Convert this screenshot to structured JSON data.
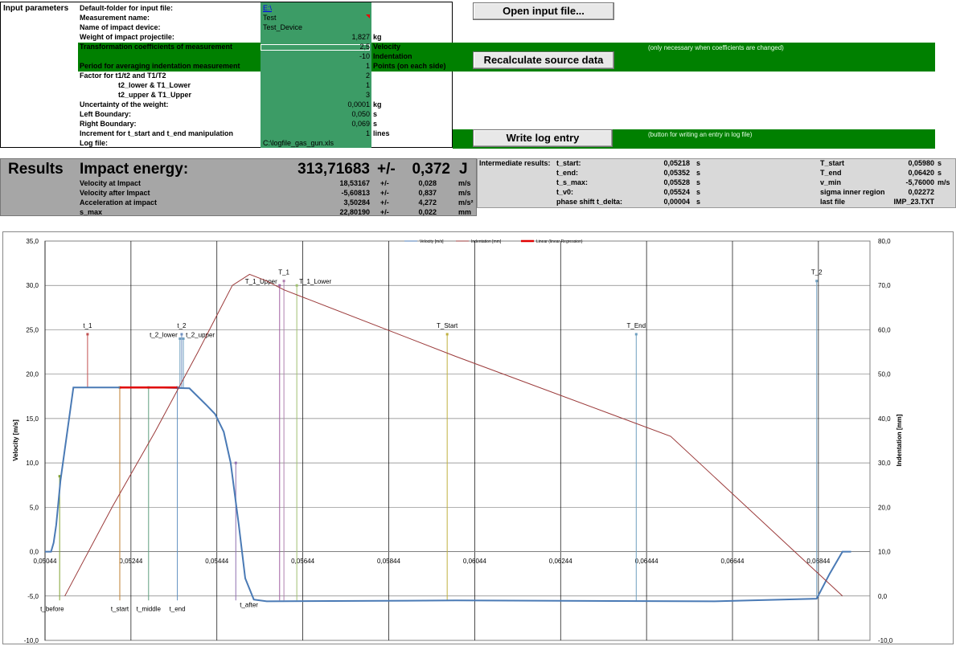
{
  "input": {
    "section_label": "Input parameters",
    "rows": [
      {
        "label": "Default-folder for input file:",
        "value": "E:\\",
        "unit": ""
      },
      {
        "label": "Measurement name:",
        "value": "Test",
        "unit": ""
      },
      {
        "label": "Name of impact device:",
        "value": "Test_Device",
        "unit": ""
      },
      {
        "label": "Weight of impact projectile:",
        "value": "1,827",
        "unit": "kg"
      },
      {
        "label": "Transformation coefficients of measurement",
        "value": "2,5",
        "unit": "Velocity"
      },
      {
        "label": "",
        "value": "-10",
        "unit": "Indentation"
      },
      {
        "label": "Period for averaging indentation measurement",
        "value": "1",
        "unit": "Points (on each side)"
      },
      {
        "label": "Factor for   t1/t2 and T1/T2",
        "value": "2",
        "unit": ""
      },
      {
        "label": "t2_lower & T1_Lower",
        "value": "1",
        "unit": ""
      },
      {
        "label": "t2_upper & T1_Upper",
        "value": "3",
        "unit": ""
      },
      {
        "label": "Uncertainty of the weight:",
        "value": "0,0001",
        "unit": "kg"
      },
      {
        "label": "Left Boundary:",
        "value": "0,050",
        "unit": "s"
      },
      {
        "label": "Right Boundary:",
        "value": "0,069",
        "unit": "s"
      },
      {
        "label": "Increment for t_start and t_end manipulation",
        "value": "1",
        "unit": "lines"
      },
      {
        "label": "Log file:",
        "value": "C:\\logfile_gas_gun.xls",
        "unit": ""
      }
    ]
  },
  "buttons": {
    "open": "Open input file...",
    "recalc": "Recalculate source data",
    "log": "Write log entry"
  },
  "notes": {
    "coeff": "(only necessary when coefficients are changed)",
    "log": "(button for writing an entry in log file)"
  },
  "results": {
    "title": "Results",
    "energy_label": "Impact energy:",
    "energy_value": "313,71683",
    "pm": "+/-",
    "energy_unc": "0,372",
    "energy_unit": "J",
    "rows": [
      {
        "label": "Velocity at Impact",
        "value": "18,53167",
        "pm": "+/-",
        "unc": "0,028",
        "unit": "m/s"
      },
      {
        "label": "Velocity after Impact",
        "value": "-5,60813",
        "pm": "+/-",
        "unc": "0,837",
        "unit": "m/s"
      },
      {
        "label": "Acceleration at impact",
        "value": "3,50284",
        "pm": "+/-",
        "unc": "4,272",
        "unit": "m/s²"
      },
      {
        "label": "s_max",
        "value": "22,80190",
        "pm": "+/-",
        "unc": "0,022",
        "unit": "mm"
      }
    ]
  },
  "intermediate": {
    "title": "Intermediate results:",
    "left": [
      {
        "label": "t_start:",
        "value": "0,05218",
        "unit": "s"
      },
      {
        "label": "t_end:",
        "value": "0,05352",
        "unit": "s"
      },
      {
        "label": "t_s_max:",
        "value": "0,05528",
        "unit": "s"
      },
      {
        "label": "t_v0:",
        "value": "0,05524",
        "unit": "s"
      },
      {
        "label": "phase shift t_delta:",
        "value": "0,00004",
        "unit": "s"
      }
    ],
    "right": [
      {
        "label": "T_start",
        "value": "0,05980",
        "unit": "s"
      },
      {
        "label": "T_end",
        "value": "0,06420",
        "unit": "s"
      },
      {
        "label": "v_min",
        "value": "-5,76000",
        "unit": "m/s"
      },
      {
        "label": "sigma inner region",
        "value": "0,02272",
        "unit": ""
      },
      {
        "label": "last file",
        "value": "IMP_23.TXT",
        "unit": ""
      }
    ]
  },
  "chart_data": {
    "type": "line",
    "ylabel": "Velocity [m/s]",
    "y2label": "Indentation [mm]",
    "ylim": [
      -10,
      35
    ],
    "y2lim": [
      -10,
      80
    ],
    "xlim": [
      0.05044,
      0.06964
    ],
    "yticks": [
      "35,0",
      "30,0",
      "25,0",
      "20,0",
      "15,0",
      "10,0",
      "5,0",
      "0,0",
      "-5,0",
      "-10,0"
    ],
    "y2ticks": [
      "80,0",
      "70,0",
      "60,0",
      "50,0",
      "40,0",
      "30,0",
      "20,0",
      "10,0",
      "0,0",
      "-10,0"
    ],
    "xticks": [
      "0,05044",
      "0,05244",
      "0,05444",
      "0,05644",
      "0,05844",
      "0,06044",
      "0,06244",
      "0,06444",
      "0,06644",
      "0,06844"
    ],
    "legend": [
      "Velocity [m/s]",
      "Indentation [mm]",
      "Linear (linear Regression)"
    ],
    "legend_position": "top",
    "grid": true,
    "series": [
      {
        "name": "Velocity [m/s]",
        "color": "#4a7ab5",
        "x": [
          0.05044,
          0.05058,
          0.05064,
          0.0507,
          0.0508,
          0.0511,
          0.053,
          0.0538,
          0.0542,
          0.0544,
          0.0546,
          0.05476,
          0.05495,
          0.0551,
          0.0553,
          0.0556,
          0.06,
          0.066,
          0.0684,
          0.0687,
          0.069,
          0.0692
        ],
        "y": [
          0,
          0,
          1,
          3,
          8,
          18.5,
          18.5,
          18.4,
          16.5,
          15.5,
          13.5,
          10,
          3,
          -3,
          -5.4,
          -5.6,
          -5.5,
          -5.6,
          -5.3,
          -2.5,
          0,
          0
        ]
      },
      {
        "name": "Indentation [mm]",
        "color": "#9b3a3a",
        "x": [
          0.0509,
          0.052,
          0.053,
          0.054,
          0.0548,
          0.0552,
          0.0556,
          0.056,
          0.06,
          0.065,
          0.069
        ],
        "y": [
          0,
          20,
          37,
          55,
          70,
          72.5,
          71,
          69,
          54,
          36,
          0
        ]
      },
      {
        "name": "Linear (linear Regression)",
        "color": "#e00000",
        "x": [
          0.05218,
          0.05352
        ],
        "y": [
          18.5,
          18.5
        ]
      }
    ],
    "markers": [
      {
        "label": "t_1",
        "x": 0.05143,
        "color": "#c05050",
        "y_top": 24.5,
        "y_bottom": 18.5,
        "pos": "top"
      },
      {
        "label": "t_2",
        "x": 0.05362,
        "color": "#7090c0",
        "y_top": 24.5,
        "y_bottom": 18.5,
        "pos": "top"
      },
      {
        "label": "t_2_lower",
        "x": 0.05358,
        "color": "#70a0c0",
        "y_top": 24.0,
        "y_bottom": 18.5,
        "pos": "topleft"
      },
      {
        "label": "t_2_upper",
        "x": 0.05366,
        "color": "#70a0c0",
        "y_top": 24.0,
        "y_bottom": 18.5,
        "pos": "topright"
      },
      {
        "label": "T_1",
        "x": 0.056,
        "color": "#b080b0",
        "y_top": 30.5,
        "y_bottom": -5.5,
        "pos": "top"
      },
      {
        "label": "T_1_Upper",
        "x": 0.0559,
        "color": "#a060a0",
        "y_top": 30.0,
        "y_bottom": -5.5,
        "pos": "topleft"
      },
      {
        "label": "T_1_Lower",
        "x": 0.0563,
        "color": "#a0c070",
        "y_top": 30.0,
        "y_bottom": -5.5,
        "pos": "topright"
      },
      {
        "label": "T_Start",
        "x": 0.0598,
        "color": "#c0b040",
        "y_top": 24.5,
        "y_bottom": -5.5,
        "pos": "top"
      },
      {
        "label": "T_End",
        "x": 0.0642,
        "color": "#70a0c0",
        "y_top": 24.5,
        "y_bottom": -5.5,
        "pos": "top"
      },
      {
        "label": "T_2",
        "x": 0.0684,
        "color": "#70a0c0",
        "y_top": 30.5,
        "y_bottom": -5.3,
        "pos": "top"
      },
      {
        "label": "t_before",
        "x": 0.05078,
        "color": "#80a030",
        "y_top": 8.5,
        "y_bottom": -5.5,
        "pos": "bottom"
      },
      {
        "label": "t_start",
        "x": 0.05218,
        "color": "#c08030",
        "y_top": 18.5,
        "y_bottom": -5.5,
        "pos": "bottom"
      },
      {
        "label": "t_middle",
        "x": 0.05285,
        "color": "#60a080",
        "y_top": 18.5,
        "y_bottom": -5.5,
        "pos": "bottom"
      },
      {
        "label": "t_end",
        "x": 0.05352,
        "color": "#6090c0",
        "y_top": 18.5,
        "y_bottom": -5.5,
        "pos": "bottom"
      },
      {
        "label": "t_after",
        "x": 0.05488,
        "color": "#9070b0",
        "y_top": 10.0,
        "y_bottom": -5.5,
        "pos": "bottom"
      }
    ]
  }
}
